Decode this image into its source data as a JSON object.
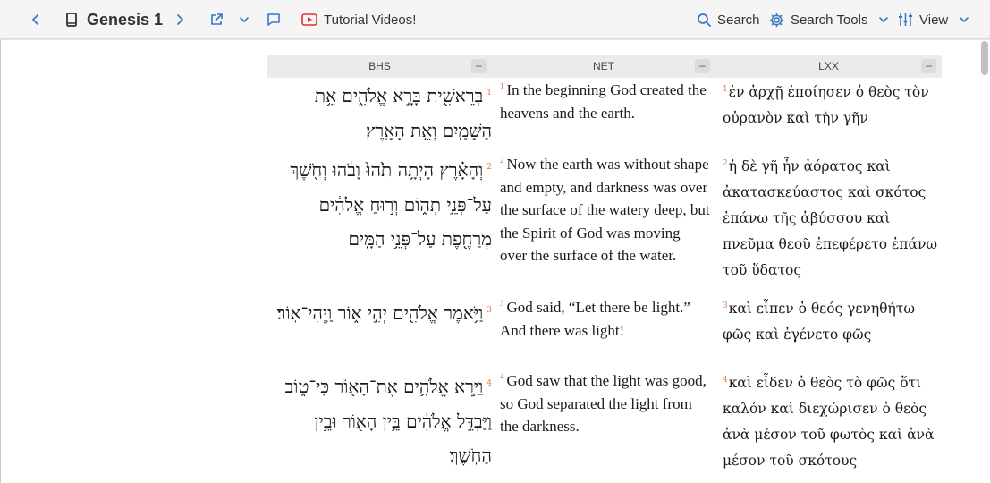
{
  "toolbar": {
    "book_title": "Genesis 1",
    "tutorial_label": "Tutorial Videos!",
    "search_label": "Search",
    "search_tools_label": "Search Tools",
    "view_label": "View"
  },
  "columns": [
    {
      "label": "BHS",
      "collapse": "–"
    },
    {
      "label": "NET",
      "collapse": "–"
    },
    {
      "label": "LXX",
      "collapse": "–"
    }
  ],
  "verses": [
    {
      "num": "1",
      "bhs": "בְּרֵאשִׁ֖ית בָּרָ֣א אֱלֹהִ֑ים אֵ֥ת הַשָּׁמַ֖יִם וְאֵ֥ת הָאָֽרֶץ׃",
      "net": "In the beginning God created the heavens and the earth.",
      "lxx": "ἐν ἀρχῇ ἐποίησεν ὁ θεὸς τὸν οὐρανὸν καὶ τὴν γῆν"
    },
    {
      "num": "2",
      "bhs": "וְהָאָ֗רֶץ הָיְתָ֥ה תֹ֙הוּ֙ וָבֹ֔הוּ וְחֹ֖שֶׁךְ עַל־פְּנֵ֣י תְה֑וֹם וְר֣וּחַ אֱלֹהִ֔ים מְרַחֶ֖פֶת עַל־פְּנֵ֥י הַמָּֽיִם׃",
      "net": "Now the earth was without shape and empty, and darkness was over the surface of the watery deep, but the Spirit of God was moving over the surface of the water.",
      "lxx": "ἡ δὲ γῆ ἦν ἀόρατος καὶ ἀκατασκεύαστος καὶ σκότος ἐπάνω τῆς ἀβύσσου καὶ πνεῦμα θεοῦ ἐπεφέρετο ἐπάνω τοῦ ὕδατος"
    },
    {
      "num": "3",
      "bhs": "וַיֹּ֥אמֶר אֱלֹהִ֖ים יְהִ֣י א֑וֹר וַֽיְהִי־אֽוֹר׃",
      "net": "God said, “Let there be light.” And there was light!",
      "lxx": "καὶ εἶπεν ὁ θεός γενηθήτω φῶς καὶ ἐγένετο φῶς"
    },
    {
      "num": "4",
      "bhs": "וַיַּ֧רְא אֱלֹהִ֛ים אֶת־הָא֖וֹר כִּי־ט֑וֹב וַיַּבְדֵּ֣ל אֱלֹהִ֔ים בֵּ֥ין הָא֖וֹר וּבֵ֥ין הַחֹֽשֶׁךְ׃",
      "net": "God saw that the light was good, so God separated the light from the darkness.",
      "lxx": "καὶ εἶδεν ὁ θεὸς τὸ φῶς ὅτι καλόν καὶ διεχώρισεν ὁ θεὸς ἀνὰ μέσον τοῦ φωτὸς καὶ ἀνὰ μέσον τοῦ σκότους"
    }
  ]
}
